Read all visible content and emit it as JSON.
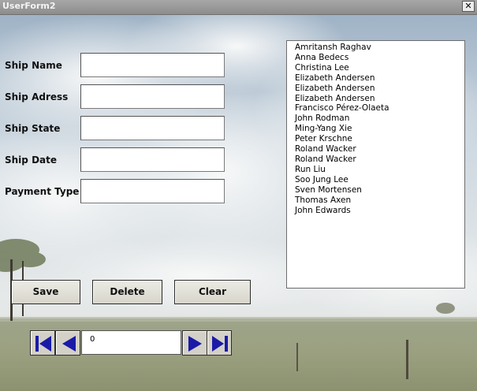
{
  "window": {
    "title": "UserForm2",
    "close_label": "✕"
  },
  "form": {
    "labels": {
      "ship_name": "Ship Name",
      "ship_adress": "Ship Adress",
      "ship_state": "Ship State",
      "ship_date": "Ship Date",
      "payment_type": "Payment Type"
    },
    "values": {
      "ship_name": "",
      "ship_adress": "",
      "ship_state": "",
      "ship_date": "",
      "payment_type": ""
    }
  },
  "listbox": {
    "items": [
      "Amritansh Raghav",
      "Anna Bedecs",
      "Christina Lee",
      "Elizabeth Andersen",
      "Elizabeth Andersen",
      "Elizabeth Andersen",
      "Francisco Pérez-Olaeta",
      "John Rodman",
      "Ming-Yang Xie",
      "Peter Krschne",
      "Roland Wacker",
      "Roland Wacker",
      "Run Liu",
      "Soo Jung Lee",
      "Sven Mortensen",
      "Thomas Axen",
      "John Edwards"
    ]
  },
  "buttons": {
    "save": "Save",
    "delete": "Delete",
    "clear": "Clear"
  },
  "navigation": {
    "record_value": "0"
  },
  "colors": {
    "nav_arrow": "#1a1aa8"
  }
}
